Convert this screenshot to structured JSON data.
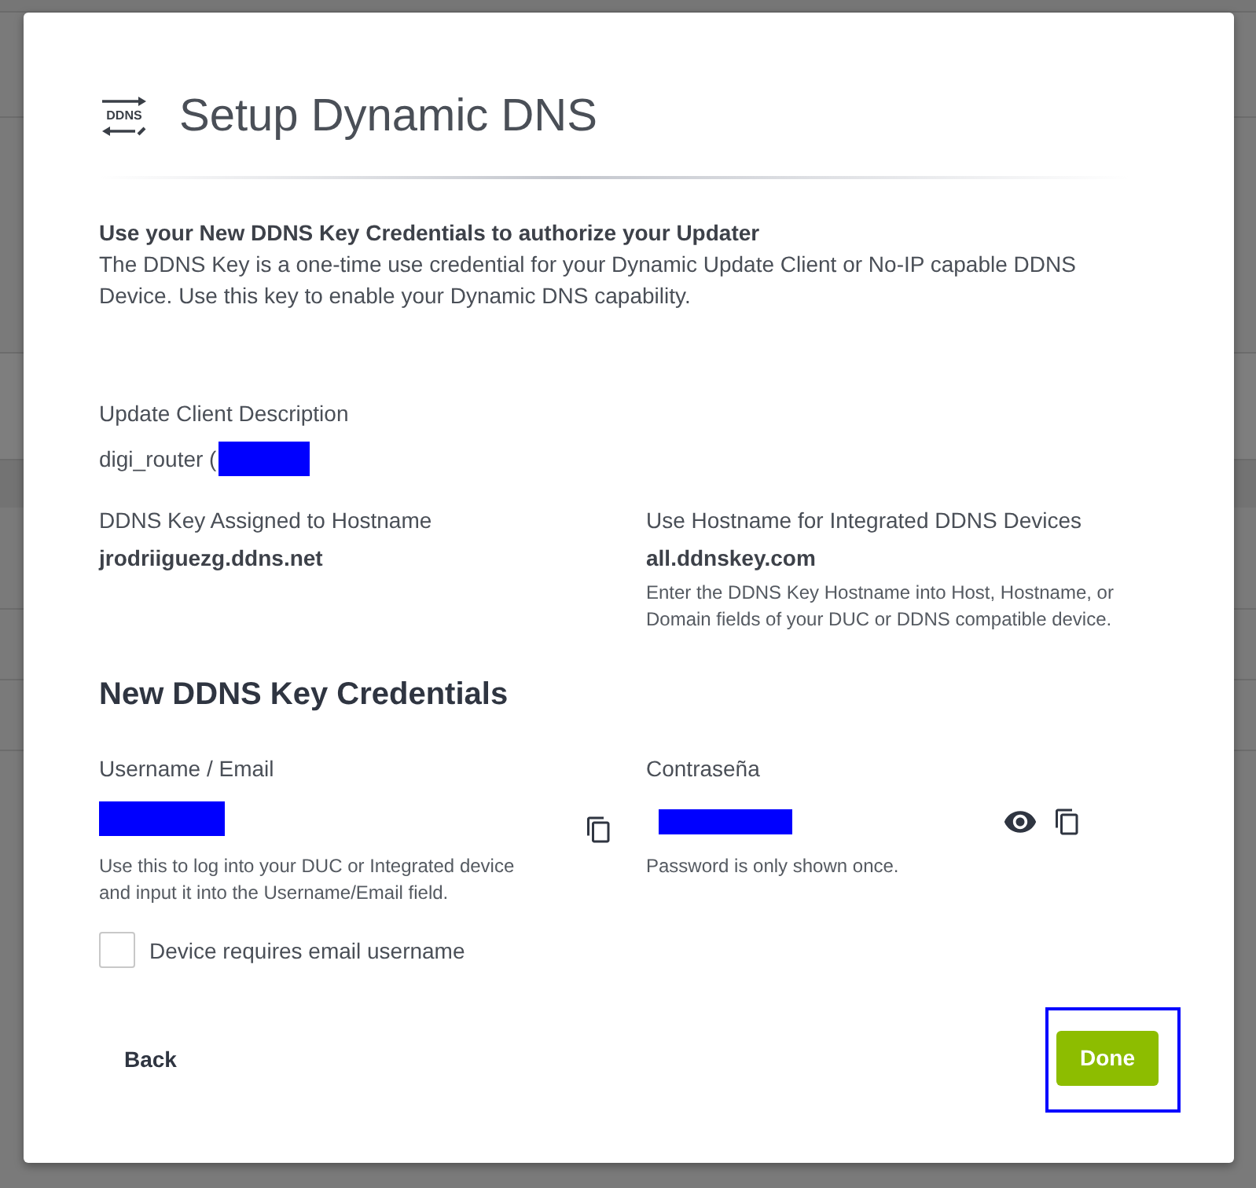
{
  "dialog": {
    "logo_text": "DDNS",
    "title": "Setup Dynamic DNS"
  },
  "intro": {
    "heading": "Use your New DDNS Key Credentials to authorize your Updater",
    "body": "The DDNS Key is a one-time use credential for your Dynamic Update Client or No-IP capable DDNS Device. Use this key to enable your Dynamic DNS capability."
  },
  "client_description": {
    "label": "Update Client Description",
    "value": "digi_router (",
    "redacted": true
  },
  "hostnames": [
    {
      "label": "DDNS Key Assigned to Hostname",
      "value": "jrodriiguezg.ddns.net"
    },
    {
      "label": "Use Hostname for Integrated DDNS Devices",
      "value": "all.ddnskey.com",
      "help": "Enter the DDNS Key Hostname into Host, Hostname, or Domain fields of your DUC or DDNS compatible device."
    }
  ],
  "credentials": {
    "title": "New DDNS Key Credentials",
    "fields": [
      {
        "label": "Username / Email",
        "redacted": true,
        "copy": true,
        "help": "Use this to log into your DUC or Integrated device and input it into the Username/Email field."
      },
      {
        "label": "Contraseña",
        "redacted": true,
        "reveal": true,
        "copy": true,
        "help": "Password is only shown once."
      }
    ]
  },
  "email_username": {
    "label": "Device requires email username",
    "checked": false
  },
  "buttons": [
    {
      "label": "Back",
      "kind": "text",
      "highlighted": false
    },
    {
      "label": "Done",
      "kind": "primary",
      "highlighted": true
    }
  ]
}
